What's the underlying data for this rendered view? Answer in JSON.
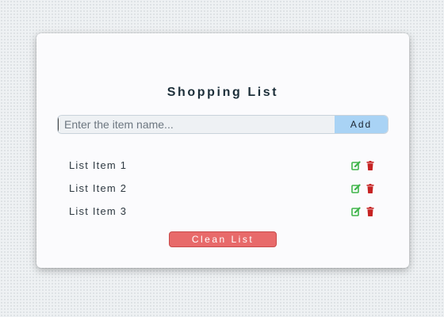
{
  "app": {
    "title": "Shopping List"
  },
  "form": {
    "input_value": "",
    "input_placeholder": "Enter the item name...",
    "add_label": "Add"
  },
  "items": [
    {
      "label": "List Item 1",
      "edit_icon": "edit-icon",
      "delete_icon": "trash-icon"
    },
    {
      "label": "List Item 2",
      "edit_icon": "edit-icon",
      "delete_icon": "trash-icon"
    },
    {
      "label": "List Item 3",
      "edit_icon": "edit-icon",
      "delete_icon": "trash-icon"
    }
  ],
  "footer": {
    "clean_label": "Clean List"
  },
  "colors": {
    "add_button": "#a9d3f5",
    "clean_button": "#e86a6a",
    "edit_icon": "#3fb54a",
    "delete_icon": "#c62323",
    "title_text": "#1d2f3a"
  }
}
